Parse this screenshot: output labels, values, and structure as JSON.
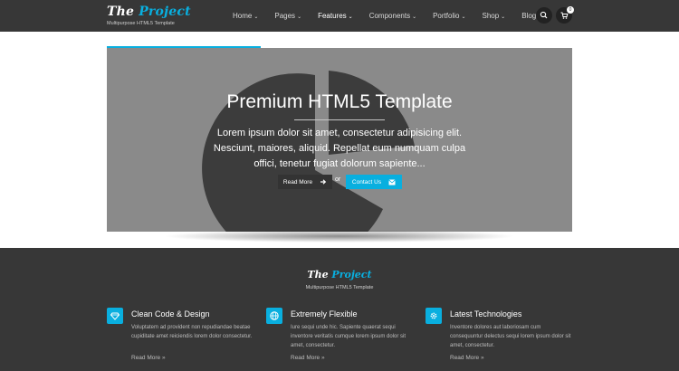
{
  "header": {
    "logo": {
      "part1": "The",
      "part2": "Project"
    },
    "tagline": "Multipurpose HTML5 Template",
    "nav": [
      {
        "label": "Home"
      },
      {
        "label": "Pages"
      },
      {
        "label": "Features"
      },
      {
        "label": "Components"
      },
      {
        "label": "Portfolio"
      },
      {
        "label": "Shop"
      },
      {
        "label": "Blog"
      }
    ],
    "cart_count": "0",
    "icons": {
      "search": "search-icon",
      "cart": "cart-icon"
    }
  },
  "hero": {
    "title": "Premium HTML5 Template",
    "text": "Lorem ipsum dolor sit amet, consectetur adipisicing elit. Nesciunt, maiores, aliquid. Repellat eum numquam culpa offici, tenetur fugiat dolorum sapiente...",
    "read_more": "Read More",
    "or": "or",
    "contact": "Contact Us"
  },
  "footer": {
    "logo": {
      "part1": "The",
      "part2": "Project"
    },
    "tagline": "Multipurpose HTML5 Template",
    "features": [
      {
        "icon": "diamond-icon",
        "title": "Clean Code & Design",
        "text": "Voluptatem ad provident non repudiandae beatae cupiditate amet reiciendis lorem dolor consectetur.",
        "more": "Read More"
      },
      {
        "icon": "globe-icon",
        "title": "Extremely Flexible",
        "text": "Iure sequi unde hic. Sapiente quaerat sequi inventore veritatis cumque lorem ipsum dolor sit amet, consectetur.",
        "more": "Read More"
      },
      {
        "icon": "gear-icon",
        "title": "Latest Technologies",
        "text": "Inventore dolores aut laboriosam cum consequuntur delectus sequi lorem ipsum dolor sit amet, consectetur.",
        "more": "Read More"
      }
    ]
  },
  "colors": {
    "accent": "#09afdf",
    "dark": "#373737",
    "hero_bg": "#8a8a8a"
  }
}
